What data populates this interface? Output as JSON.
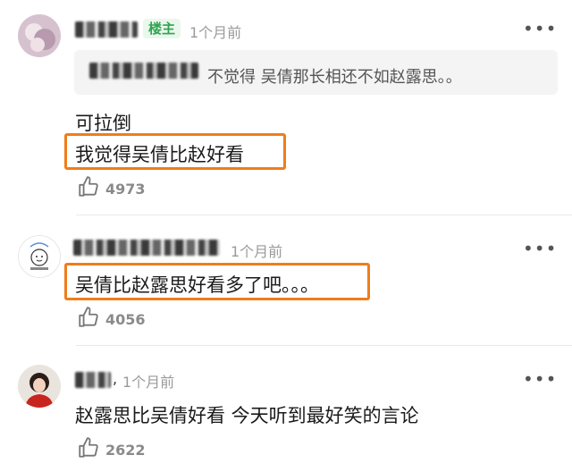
{
  "comments": [
    {
      "badge": "楼主",
      "time": "1个月前",
      "more": "•••",
      "quote": "不觉得 吴倩那长相还不如赵露思。。",
      "line1": "可拉倒",
      "line2": "我觉得吴倩比赵好看",
      "likes": "4973"
    },
    {
      "time": "1个月前",
      "more": "•••",
      "text": "吴倩比赵露思好看多了吧。。。",
      "likes": "4056"
    },
    {
      "name_suffix": ",",
      "time": "1个月前",
      "more": "•••",
      "text": "赵露思比吴倩好看 今天听到最好笑的言论",
      "likes": "2622"
    }
  ],
  "colors": {
    "highlight": "#ef7d1a",
    "badge_text": "#2ea44f",
    "badge_bg": "#e9f7ec"
  }
}
